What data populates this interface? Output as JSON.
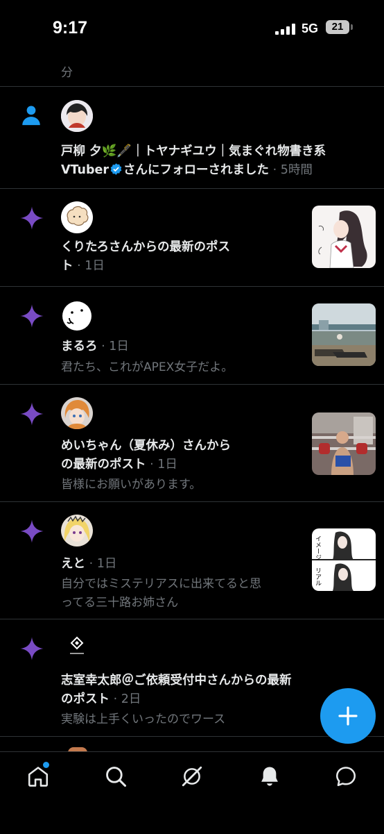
{
  "status_bar": {
    "time": "9:17",
    "network": "5G",
    "battery": "21"
  },
  "top_cutoff": {
    "text": "分"
  },
  "notifications": [
    {
      "type": "follow",
      "name": "戸柳 夕🌿🖋️｜トヤナギユウ｜気まぐれ物書き系VTuber",
      "line1": "戸柳 夕🌿🖋️｜トヤナギユウ｜気まぐれ物書き系",
      "line2_name": "VTuber",
      "line2_text": "さんにフォローされました",
      "time": "5時間"
    },
    {
      "type": "post",
      "line1": "くりたろさんからの最新のポス",
      "line2": "ト",
      "time": "1日"
    },
    {
      "type": "post",
      "line1": "まるろ",
      "time": "1日",
      "sub1": "君たち、これがAPEX女子だよ。"
    },
    {
      "type": "post",
      "line1": "めいちゃん（夏休み）さんから",
      "line2": "の最新のポスト",
      "time": "1日",
      "sub1": "皆様にお願いがあります。"
    },
    {
      "type": "post",
      "line1": "えと",
      "time": "1日",
      "sub1": "自分ではミステリアスに出来てると思",
      "sub2": "ってる三十路お姉さん"
    },
    {
      "type": "post",
      "line1": "志室幸太郎＠ご依頼受付中さんからの最新",
      "line2": "のポスト",
      "time": "2日",
      "sub1": "実験は上手くいったのでワース"
    }
  ],
  "meta_sep": " · ",
  "thumbs": {
    "t1_words": "イメージ",
    "t2_words": "リアル"
  },
  "colors": {
    "accent": "#1d9bf0",
    "sparkle": "#794bc4",
    "background": "#000000",
    "muted": "#71767b"
  },
  "icons": [
    "person-icon",
    "sparkle-icon",
    "home-icon",
    "search-icon",
    "grok-icon",
    "bell-icon",
    "messages-icon",
    "plus-icon"
  ],
  "fab": {
    "label": "+"
  }
}
